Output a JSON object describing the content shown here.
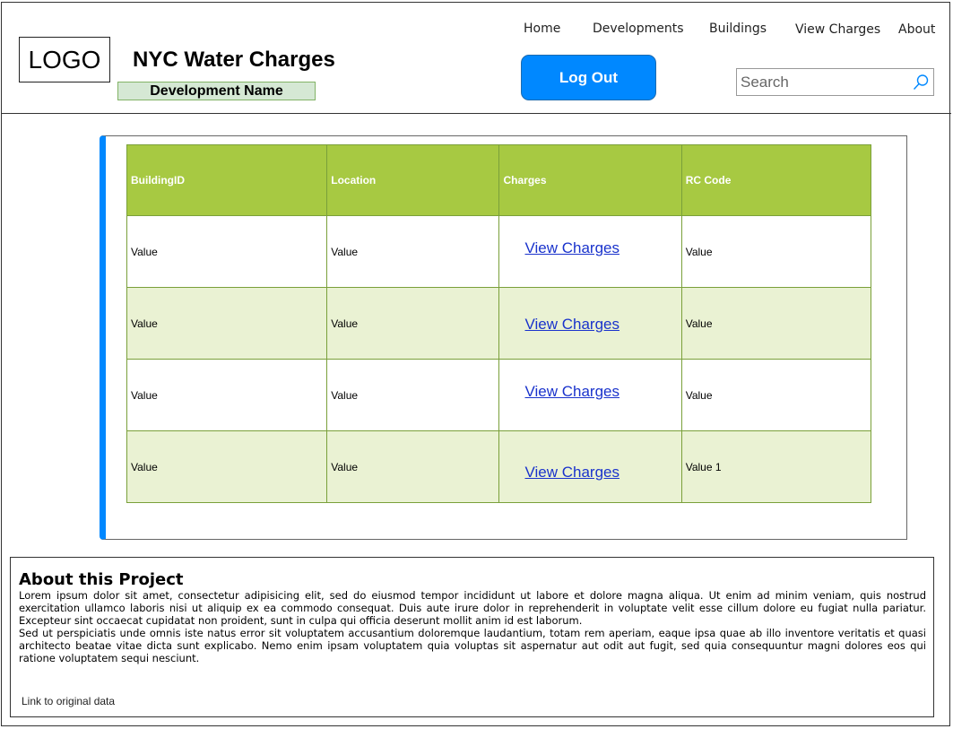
{
  "header": {
    "logo": "LOGO",
    "title": "NYC Water Charges",
    "development_name": "Development Name",
    "nav": [
      "Home",
      "Developments",
      "Buildings",
      "View Charges",
      "About"
    ],
    "logout_label": "Log Out",
    "search_placeholder": "Search"
  },
  "table": {
    "columns": [
      "BuildingID",
      "Location",
      "Charges",
      "RC Code"
    ],
    "rows": [
      {
        "building_id": "Value",
        "location": "Value",
        "charges": "View Charges",
        "rc_code": "Value"
      },
      {
        "building_id": "Value",
        "location": "Value",
        "charges": "View Charges",
        "rc_code": "Value"
      },
      {
        "building_id": "Value",
        "location": "Value",
        "charges": "View Charges",
        "rc_code": "Value"
      },
      {
        "building_id": "Value",
        "location": "Value",
        "charges": "View Charges",
        "rc_code": "Value 1"
      }
    ]
  },
  "about": {
    "title": "About this Project",
    "paragraph1": "Lorem ipsum dolor sit amet, consectetur adipisicing elit, sed do eiusmod tempor incididunt ut labore et dolore magna aliqua. Ut enim ad minim veniam, quis nostrud exercitation ullamco laboris nisi ut aliquip ex ea commodo consequat. Duis aute irure dolor in reprehenderit in voluptate velit esse cillum dolore eu fugiat nulla pariatur. Excepteur sint occaecat cupidatat non proident, sunt in culpa qui officia deserunt mollit anim id est laborum.",
    "paragraph2": "Sed ut perspiciatis unde omnis iste natus error sit voluptatem accusantium doloremque laudantium, totam rem aperiam, eaque ipsa quae ab illo inventore veritatis et quasi architecto beatae vitae dicta sunt explicabo. Nemo enim ipsam voluptatem quia voluptas sit aspernatur aut odit aut fugit, sed quia consequuntur magni dolores eos qui ratione voluptatem sequi nesciunt.",
    "link_label": "Link to original data"
  },
  "colors": {
    "accent_blue": "#0088ff",
    "table_header": "#a7c942",
    "row_alt": "#eaf2d3",
    "dev_name_bg": "#d5e8d4",
    "link": "#1a33cc"
  },
  "icons": {
    "search": "search-icon"
  }
}
